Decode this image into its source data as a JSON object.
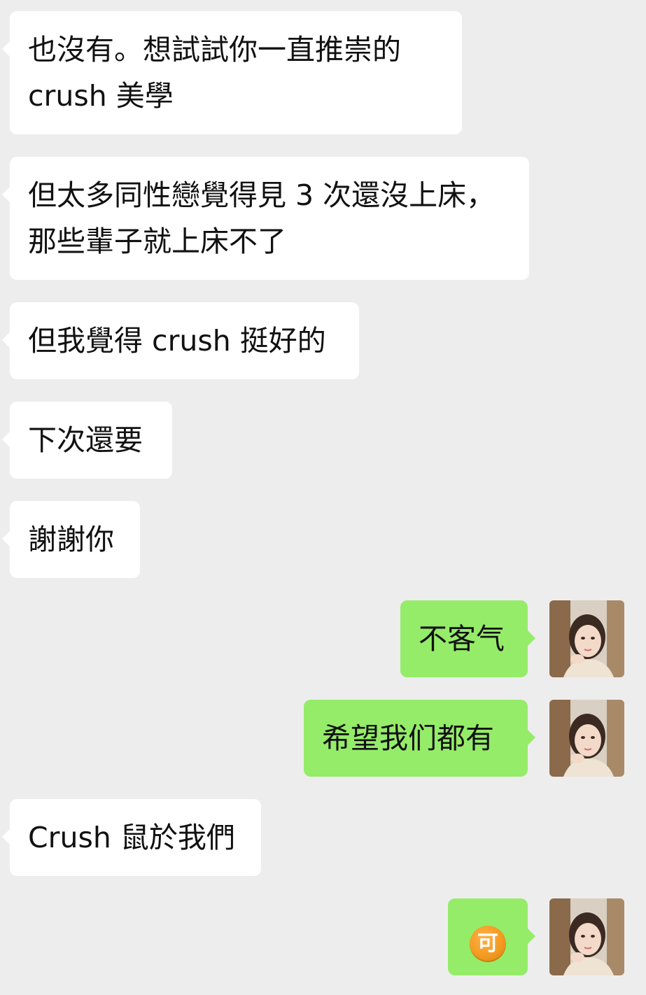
{
  "messages": [
    {
      "side": "incoming",
      "lines": [
        "也沒有。想試試你一直推崇的",
        "crush 美學"
      ]
    },
    {
      "side": "incoming",
      "lines": [
        "但太多同性戀覺得見 3 次還沒上床，",
        "那些輩子就上床不了"
      ]
    },
    {
      "side": "incoming",
      "lines": [
        "但我覺得 crush 挺好的"
      ]
    },
    {
      "side": "incoming",
      "lines": [
        "下次還要"
      ]
    },
    {
      "side": "incoming",
      "lines": [
        "謝謝你"
      ]
    },
    {
      "side": "outgoing",
      "lines": [
        "不客气"
      ],
      "avatar": "user-avatar"
    },
    {
      "side": "outgoing",
      "lines": [
        "希望我们都有"
      ],
      "avatar": "user-avatar"
    },
    {
      "side": "incoming",
      "lines": [
        "Crush 鼠於我們"
      ]
    },
    {
      "side": "outgoing",
      "emoji": {
        "icon": "ke-emoji-icon",
        "glyph": "可"
      },
      "avatar": "user-avatar"
    }
  ],
  "colors": {
    "background": "#ededed",
    "incoming_bubble": "#ffffff",
    "outgoing_bubble": "#95ec69",
    "text": "#111111",
    "emoji_orange": "#f39a21"
  }
}
